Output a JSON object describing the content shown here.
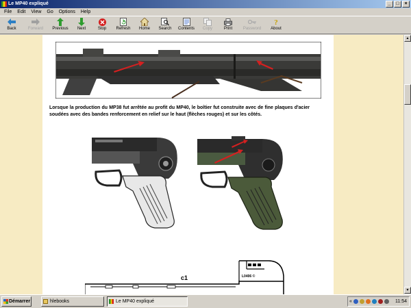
{
  "window": {
    "title": "Le MP40 expliqué"
  },
  "menu": [
    "File",
    "Edit",
    "View",
    "Go",
    "Options",
    "Help"
  ],
  "toolbar": [
    {
      "label": "Back",
      "icon": "back-arrow-icon",
      "enabled": true
    },
    {
      "label": "Forward",
      "icon": "forward-arrow-icon",
      "enabled": false
    },
    {
      "label": "Previous",
      "icon": "up-arrow-icon",
      "enabled": true
    },
    {
      "label": "Next",
      "icon": "down-arrow-icon",
      "enabled": true
    },
    {
      "label": "Stop",
      "icon": "stop-icon",
      "enabled": true
    },
    {
      "label": "Refresh",
      "icon": "refresh-icon",
      "enabled": true
    },
    {
      "label": "Home",
      "icon": "home-icon",
      "enabled": true
    },
    {
      "label": "Search",
      "icon": "search-icon",
      "enabled": true
    },
    {
      "label": "Contents",
      "icon": "contents-icon",
      "enabled": true
    },
    {
      "label": "Copy",
      "icon": "copy-icon",
      "enabled": false
    },
    {
      "label": "Print",
      "icon": "print-icon",
      "enabled": true
    },
    {
      "label": "Password",
      "icon": "key-icon",
      "enabled": false
    },
    {
      "label": "About",
      "icon": "about-icon",
      "enabled": true
    }
  ],
  "content": {
    "paragraph": "Lorsque la production du MP38 fut arrêtée au profit du MP40, le boîtier fut construite avec de fine plaques d'acier soudées avec des bandes renforcement en relief sur le haut (flèches rouges) et sur les côtés.",
    "drawing_label": "c1",
    "drawing_number": "L0406 ©"
  },
  "taskbar": {
    "start_label": "Démarrer",
    "tasks": [
      {
        "label": "hlebooks",
        "active": false
      },
      {
        "label": "Le MP40 expliqué",
        "active": true
      }
    ],
    "clock": "11:54"
  },
  "colors": {
    "page_bg": "#f7ebc3",
    "title_start": "#0a246a",
    "arrow": "#d42020"
  }
}
